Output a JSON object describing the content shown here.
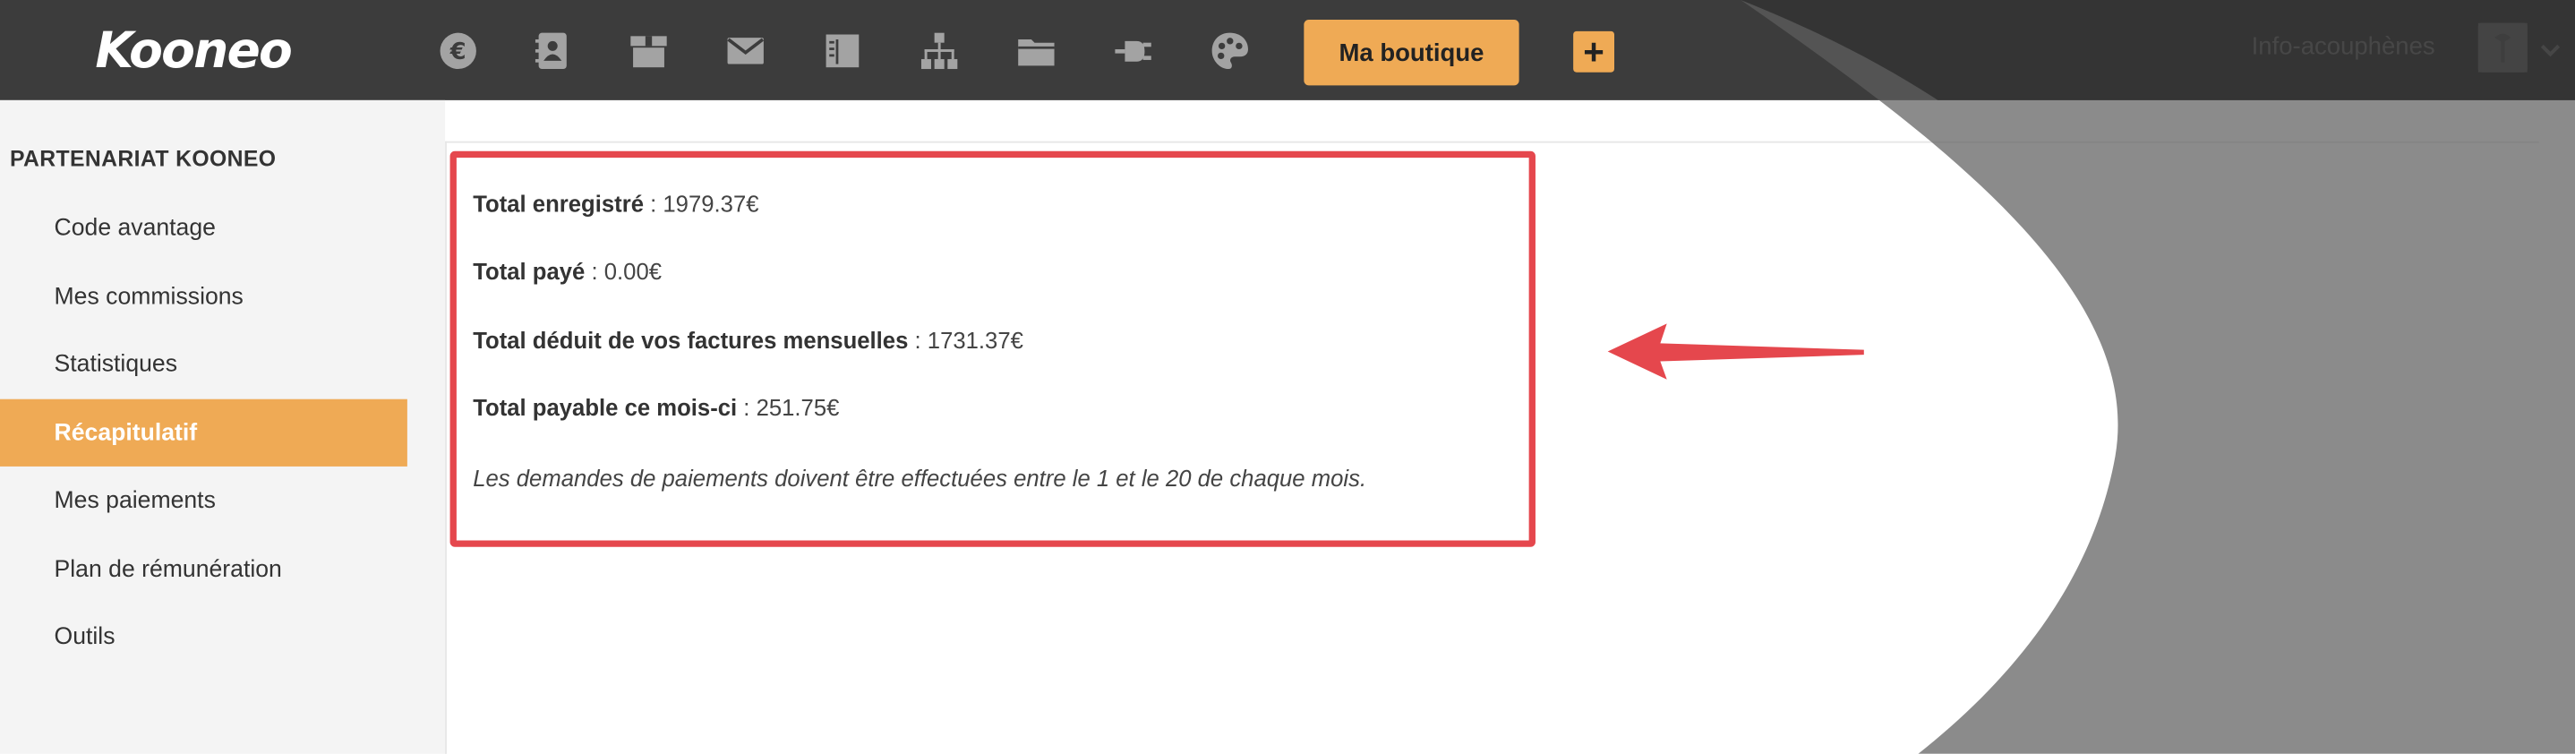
{
  "header": {
    "logo": "Kooneo",
    "nav_icons": [
      "euro-icon",
      "address-book-icon",
      "box-icon",
      "envelope-icon",
      "columns-icon",
      "sitemap-icon",
      "folder-icon",
      "plug-icon",
      "palette-icon"
    ],
    "shop_button": "Ma boutique",
    "plus_button": "+",
    "user_name": "Info-acouphènes"
  },
  "sidebar": {
    "title": "PARTENARIAT KOONEO",
    "items": [
      {
        "label": "Code avantage",
        "active": false
      },
      {
        "label": "Mes commissions",
        "active": false
      },
      {
        "label": "Statistiques",
        "active": false
      },
      {
        "label": "Récapitulatif",
        "active": true
      },
      {
        "label": "Mes paiements",
        "active": false
      },
      {
        "label": "Plan de rémunération",
        "active": false
      },
      {
        "label": "Outils",
        "active": false
      }
    ]
  },
  "summary": {
    "lines": [
      {
        "label": "Total enregistré",
        "value": ": 1979.37€"
      },
      {
        "label": "Total payé",
        "value": ": 0.00€"
      },
      {
        "label": "Total déduit de vos factures mensuelles",
        "value": ": 1731.37€"
      },
      {
        "label": "Total payable ce mois-ci",
        "value": ": 251.75€"
      }
    ],
    "note": "Les demandes de paiements doivent être effectuées entre le 1 et le 20 de chaque mois."
  },
  "colors": {
    "topbar": "#3c3c3c",
    "accent": "#efaa55",
    "annotation_red": "#e5474d",
    "overlay_gray": "#5e5e5e"
  }
}
